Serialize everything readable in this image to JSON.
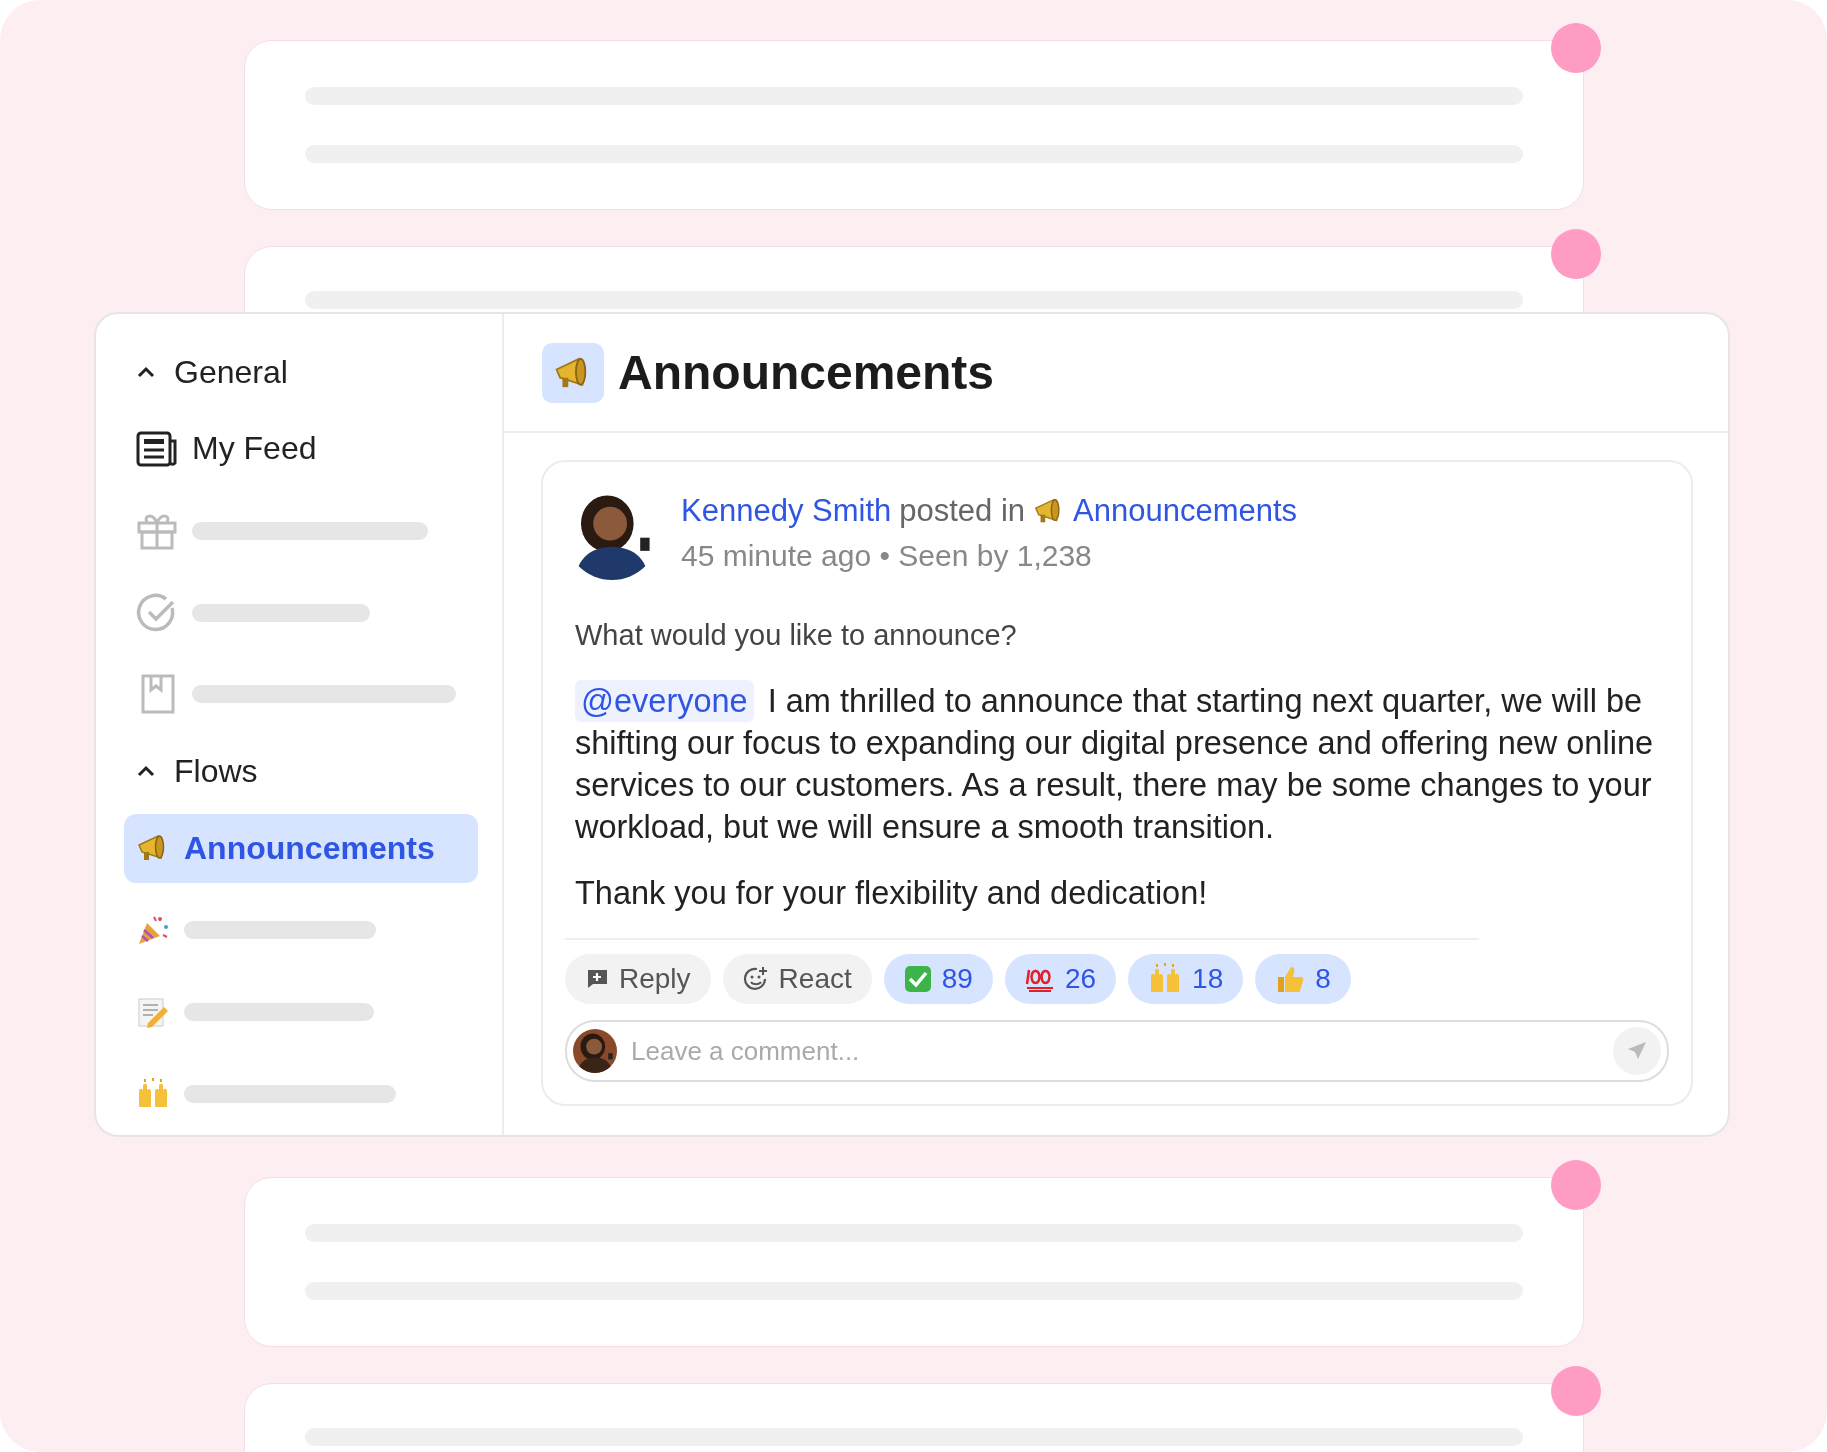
{
  "sidebar": {
    "sections": [
      {
        "title": "General",
        "expanded": true,
        "items": [
          {
            "kind": "feed",
            "label": "My Feed",
            "selected": false
          },
          {
            "kind": "gift",
            "selected": false
          },
          {
            "kind": "check",
            "selected": false
          },
          {
            "kind": "bookmark",
            "selected": false
          }
        ]
      },
      {
        "title": "Flows",
        "expanded": true,
        "items": [
          {
            "kind": "megaphone",
            "label": "Announcements",
            "selected": true
          },
          {
            "kind": "party",
            "selected": false
          },
          {
            "kind": "memo",
            "selected": false
          },
          {
            "kind": "hands",
            "selected": false
          }
        ]
      }
    ]
  },
  "header": {
    "title": "Announcements"
  },
  "post": {
    "author": "Kennedy Smith",
    "action": "posted in",
    "channel": "Announcements",
    "meta": "45 minute ago • Seen by 1,238",
    "prompt": "What would you like to announce?",
    "mention": "@everyone",
    "body": "I am thrilled to announce that starting next quarter, we will be shifting our focus to expanding our digital presence and offering new online services to our customers. As a result, there may be some changes to your workload, but we will ensure a smooth transition.",
    "closing": "Thank you for your flexibility and dedication!",
    "actions": [
      {
        "kind": "reply",
        "label": "Reply"
      },
      {
        "kind": "react",
        "label": "React"
      }
    ],
    "reactions": [
      {
        "kind": "check",
        "count": "89"
      },
      {
        "kind": "hundred",
        "count": "26"
      },
      {
        "kind": "hands",
        "count": "18"
      },
      {
        "kind": "thumbs",
        "count": "8"
      }
    ],
    "comment": {
      "placeholder": "Leave a comment..."
    }
  }
}
